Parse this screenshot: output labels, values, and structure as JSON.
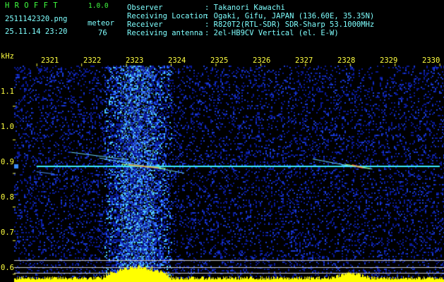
{
  "header": {
    "app_name": "H R O F F T",
    "version": "1.0.0",
    "filename": "2511142320.png",
    "timestamp": "25.11.14 23:20",
    "mode_label": "meteor",
    "count": "76",
    "rows": [
      {
        "label": "Observer",
        "value": ": Takanori Kawachi"
      },
      {
        "label": "Receiving Location",
        "value": ": Ogaki, Gifu, JAPAN (136.60E, 35.35N)"
      },
      {
        "label": "Receiver",
        "value": ": R820T2(RTL-SDR) SDR-Sharp 53.1000MHz"
      },
      {
        "label": "Receiving antenna",
        "value": ": 2el-HB9CV Vertical (el. E-W)"
      }
    ]
  },
  "colors": {
    "background": "#000000",
    "text_cyan": "#7fffff",
    "text_yellow": "#ffff40",
    "text_green": "#40ff40",
    "noise": "#0a1a9a",
    "signal_line": "#3cf0ff",
    "hot": "#ff4040",
    "spectrum_bar": "#ffff00"
  },
  "chart_data": {
    "type": "heatmap",
    "x_unit_label": "",
    "y_unit_label": "kHz",
    "x_ticks": [
      "2321",
      "2322",
      "2323",
      "2324",
      "2325",
      "2326",
      "2327",
      "2328",
      "2329",
      "2330"
    ],
    "y_ticks": [
      "1.1",
      "1.0",
      "0.9",
      "0.8",
      "0.7",
      "0.6"
    ],
    "xlim": [
      2320.5,
      2330.1
    ],
    "ylim": [
      0.58,
      1.22
    ],
    "carrier_khz": 0.92,
    "meteor_bursts": [
      {
        "x_start": 2322.4,
        "x_end": 2324.3,
        "freq_start": 0.945,
        "freq_end": 0.9
      },
      {
        "x_start": 2327.8,
        "x_end": 2328.5,
        "freq_start": 0.925,
        "freq_end": 0.912
      }
    ],
    "broadband_noise": {
      "x_start": 2322.5,
      "x_end": 2324.0
    }
  }
}
